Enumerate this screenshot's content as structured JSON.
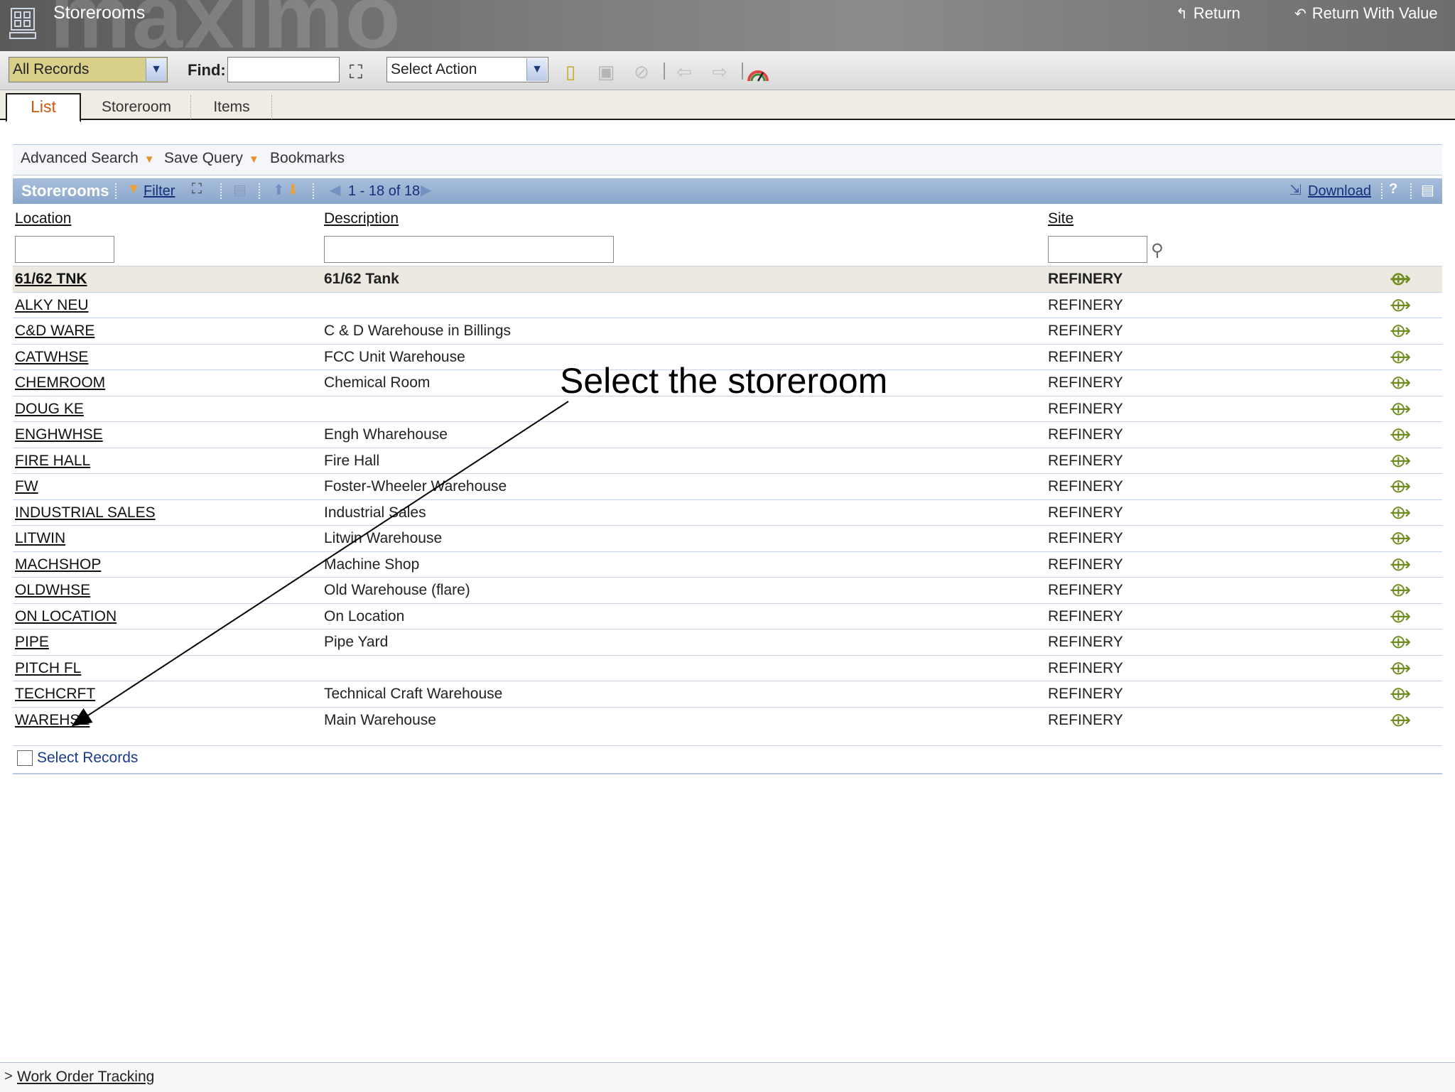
{
  "header": {
    "app_title": "Storerooms",
    "watermark": "maximo",
    "return_label": "Return",
    "return_with_value_label": "Return With Value"
  },
  "toolbar": {
    "query_select": "All Records",
    "find_label": "Find:",
    "find_value": "",
    "action_select": "Select Action"
  },
  "tabs": [
    {
      "label": "List",
      "active": true
    },
    {
      "label": "Storeroom",
      "active": false
    },
    {
      "label": "Items",
      "active": false
    }
  ],
  "query_bar": {
    "advanced_search": "Advanced Search",
    "save_query": "Save Query",
    "bookmarks": "Bookmarks"
  },
  "table": {
    "title": "Storerooms",
    "filter_label": "Filter",
    "pagination": "1 - 18 of 18",
    "download_label": "Download",
    "help": "?",
    "columns": {
      "location": "Location",
      "description": "Description",
      "site": "Site"
    },
    "rows": [
      {
        "location": "61/62 TNK",
        "description": "61/62 Tank",
        "site": "REFINERY"
      },
      {
        "location": "ALKY NEU",
        "description": "",
        "site": "REFINERY"
      },
      {
        "location": "C&D WARE",
        "description": "C & D Warehouse in Billings",
        "site": "REFINERY"
      },
      {
        "location": "CATWHSE",
        "description": "FCC Unit Warehouse",
        "site": "REFINERY"
      },
      {
        "location": "CHEMROOM",
        "description": "Chemical Room",
        "site": "REFINERY"
      },
      {
        "location": "DOUG KE",
        "description": "",
        "site": "REFINERY"
      },
      {
        "location": "ENGHWHSE",
        "description": "Engh Wharehouse",
        "site": "REFINERY"
      },
      {
        "location": "FIRE HALL",
        "description": "Fire Hall",
        "site": "REFINERY"
      },
      {
        "location": "FW",
        "description": "Foster-Wheeler Warehouse",
        "site": "REFINERY"
      },
      {
        "location": "INDUSTRIAL SALES",
        "description": "Industrial Sales",
        "site": "REFINERY"
      },
      {
        "location": "LITWIN",
        "description": "Litwin Warehouse",
        "site": "REFINERY"
      },
      {
        "location": "MACHSHOP",
        "description": "Machine Shop",
        "site": "REFINERY"
      },
      {
        "location": "OLDWHSE",
        "description": "Old Warehouse (flare)",
        "site": "REFINERY"
      },
      {
        "location": "ON LOCATION",
        "description": "On Location",
        "site": "REFINERY"
      },
      {
        "location": "PIPE",
        "description": "Pipe Yard",
        "site": "REFINERY"
      },
      {
        "location": "PITCH FL",
        "description": "",
        "site": "REFINERY"
      },
      {
        "location": "TECHCRFT",
        "description": "Technical Craft Warehouse",
        "site": "REFINERY"
      },
      {
        "location": "WAREHSE",
        "description": "Main Warehouse",
        "site": "REFINERY"
      }
    ],
    "select_records_label": "Select Records"
  },
  "annotation": {
    "text": "Select the storeroom"
  },
  "footer": {
    "arrow": ">",
    "link": "Work Order Tracking"
  }
}
